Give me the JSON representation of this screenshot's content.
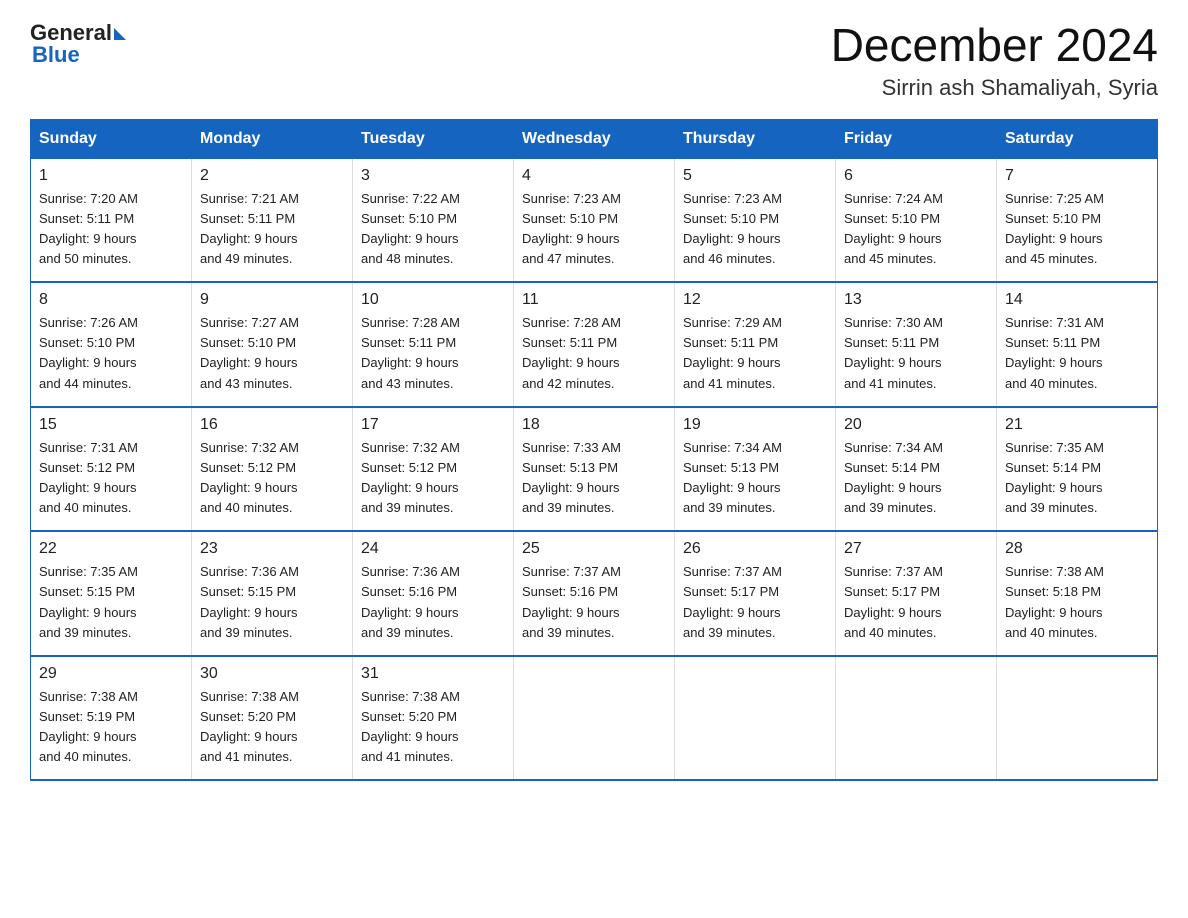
{
  "header": {
    "logo_general": "General",
    "logo_blue": "Blue",
    "month_title": "December 2024",
    "location": "Sirrin ash Shamaliyah, Syria"
  },
  "days_of_week": [
    "Sunday",
    "Monday",
    "Tuesday",
    "Wednesday",
    "Thursday",
    "Friday",
    "Saturday"
  ],
  "weeks": [
    [
      {
        "day": "1",
        "sunrise": "7:20 AM",
        "sunset": "5:11 PM",
        "daylight": "9 hours and 50 minutes."
      },
      {
        "day": "2",
        "sunrise": "7:21 AM",
        "sunset": "5:11 PM",
        "daylight": "9 hours and 49 minutes."
      },
      {
        "day": "3",
        "sunrise": "7:22 AM",
        "sunset": "5:10 PM",
        "daylight": "9 hours and 48 minutes."
      },
      {
        "day": "4",
        "sunrise": "7:23 AM",
        "sunset": "5:10 PM",
        "daylight": "9 hours and 47 minutes."
      },
      {
        "day": "5",
        "sunrise": "7:23 AM",
        "sunset": "5:10 PM",
        "daylight": "9 hours and 46 minutes."
      },
      {
        "day": "6",
        "sunrise": "7:24 AM",
        "sunset": "5:10 PM",
        "daylight": "9 hours and 45 minutes."
      },
      {
        "day": "7",
        "sunrise": "7:25 AM",
        "sunset": "5:10 PM",
        "daylight": "9 hours and 45 minutes."
      }
    ],
    [
      {
        "day": "8",
        "sunrise": "7:26 AM",
        "sunset": "5:10 PM",
        "daylight": "9 hours and 44 minutes."
      },
      {
        "day": "9",
        "sunrise": "7:27 AM",
        "sunset": "5:10 PM",
        "daylight": "9 hours and 43 minutes."
      },
      {
        "day": "10",
        "sunrise": "7:28 AM",
        "sunset": "5:11 PM",
        "daylight": "9 hours and 43 minutes."
      },
      {
        "day": "11",
        "sunrise": "7:28 AM",
        "sunset": "5:11 PM",
        "daylight": "9 hours and 42 minutes."
      },
      {
        "day": "12",
        "sunrise": "7:29 AM",
        "sunset": "5:11 PM",
        "daylight": "9 hours and 41 minutes."
      },
      {
        "day": "13",
        "sunrise": "7:30 AM",
        "sunset": "5:11 PM",
        "daylight": "9 hours and 41 minutes."
      },
      {
        "day": "14",
        "sunrise": "7:31 AM",
        "sunset": "5:11 PM",
        "daylight": "9 hours and 40 minutes."
      }
    ],
    [
      {
        "day": "15",
        "sunrise": "7:31 AM",
        "sunset": "5:12 PM",
        "daylight": "9 hours and 40 minutes."
      },
      {
        "day": "16",
        "sunrise": "7:32 AM",
        "sunset": "5:12 PM",
        "daylight": "9 hours and 40 minutes."
      },
      {
        "day": "17",
        "sunrise": "7:32 AM",
        "sunset": "5:12 PM",
        "daylight": "9 hours and 39 minutes."
      },
      {
        "day": "18",
        "sunrise": "7:33 AM",
        "sunset": "5:13 PM",
        "daylight": "9 hours and 39 minutes."
      },
      {
        "day": "19",
        "sunrise": "7:34 AM",
        "sunset": "5:13 PM",
        "daylight": "9 hours and 39 minutes."
      },
      {
        "day": "20",
        "sunrise": "7:34 AM",
        "sunset": "5:14 PM",
        "daylight": "9 hours and 39 minutes."
      },
      {
        "day": "21",
        "sunrise": "7:35 AM",
        "sunset": "5:14 PM",
        "daylight": "9 hours and 39 minutes."
      }
    ],
    [
      {
        "day": "22",
        "sunrise": "7:35 AM",
        "sunset": "5:15 PM",
        "daylight": "9 hours and 39 minutes."
      },
      {
        "day": "23",
        "sunrise": "7:36 AM",
        "sunset": "5:15 PM",
        "daylight": "9 hours and 39 minutes."
      },
      {
        "day": "24",
        "sunrise": "7:36 AM",
        "sunset": "5:16 PM",
        "daylight": "9 hours and 39 minutes."
      },
      {
        "day": "25",
        "sunrise": "7:37 AM",
        "sunset": "5:16 PM",
        "daylight": "9 hours and 39 minutes."
      },
      {
        "day": "26",
        "sunrise": "7:37 AM",
        "sunset": "5:17 PM",
        "daylight": "9 hours and 39 minutes."
      },
      {
        "day": "27",
        "sunrise": "7:37 AM",
        "sunset": "5:17 PM",
        "daylight": "9 hours and 40 minutes."
      },
      {
        "day": "28",
        "sunrise": "7:38 AM",
        "sunset": "5:18 PM",
        "daylight": "9 hours and 40 minutes."
      }
    ],
    [
      {
        "day": "29",
        "sunrise": "7:38 AM",
        "sunset": "5:19 PM",
        "daylight": "9 hours and 40 minutes."
      },
      {
        "day": "30",
        "sunrise": "7:38 AM",
        "sunset": "5:20 PM",
        "daylight": "9 hours and 41 minutes."
      },
      {
        "day": "31",
        "sunrise": "7:38 AM",
        "sunset": "5:20 PM",
        "daylight": "9 hours and 41 minutes."
      },
      null,
      null,
      null,
      null
    ]
  ],
  "labels": {
    "sunrise": "Sunrise:",
    "sunset": "Sunset:",
    "daylight": "Daylight:"
  }
}
